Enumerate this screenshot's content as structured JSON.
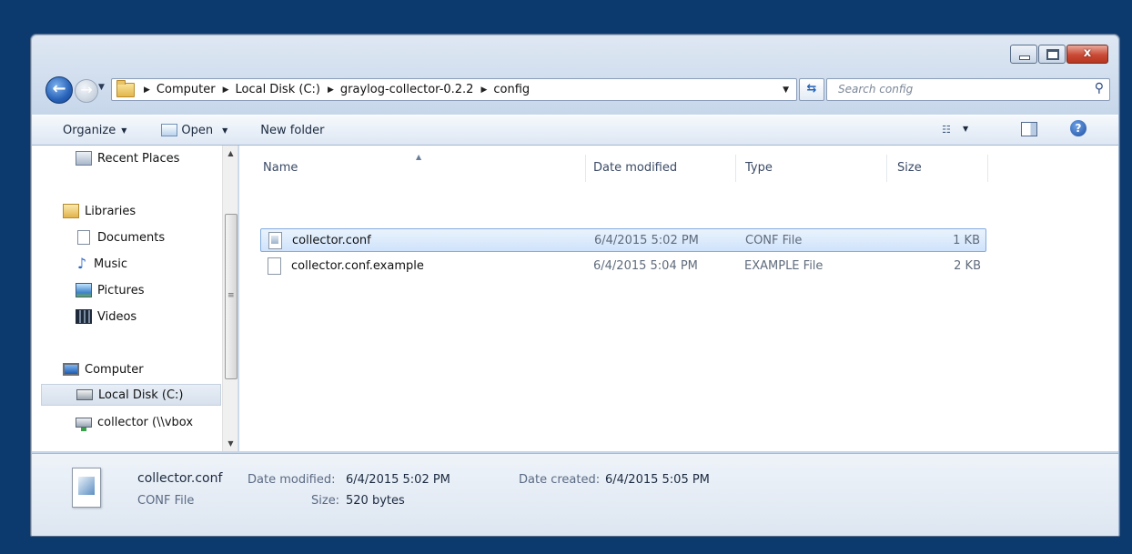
{
  "window": {
    "caption": {
      "minimize": "–",
      "maximize": "□",
      "close": "x"
    }
  },
  "address_bar": {
    "crumbs": [
      "Computer",
      "Local Disk (C:)",
      "graylog-collector-0.2.2",
      "config"
    ],
    "search_placeholder": "Search config"
  },
  "toolbar": {
    "organize": "Organize",
    "open": "Open",
    "new_folder": "New folder"
  },
  "nav": {
    "items": [
      {
        "label": "Recent Places",
        "icon": "recent-places-icon"
      },
      {
        "label": "Libraries",
        "icon": "libraries-icon"
      },
      {
        "label": "Documents",
        "icon": "documents-icon"
      },
      {
        "label": "Music",
        "icon": "music-icon"
      },
      {
        "label": "Pictures",
        "icon": "pictures-icon"
      },
      {
        "label": "Videos",
        "icon": "videos-icon"
      },
      {
        "label": "Computer",
        "icon": "computer-icon"
      },
      {
        "label": "Local Disk (C:)",
        "icon": "local-disk-icon",
        "selected": true
      },
      {
        "label": "collector (\\\\vbox",
        "icon": "network-drive-icon"
      }
    ]
  },
  "file_list": {
    "columns": [
      "Name",
      "Date modified",
      "Type",
      "Size"
    ],
    "rows": [
      {
        "name": "collector.conf",
        "date": "6/4/2015 5:02 PM",
        "type": "CONF File",
        "size": "1 KB",
        "selected": true
      },
      {
        "name": "collector.conf.example",
        "date": "6/4/2015 5:04 PM",
        "type": "EXAMPLE File",
        "size": "2 KB",
        "selected": false
      }
    ]
  },
  "details": {
    "name": "collector.conf",
    "type": "CONF File",
    "date_modified_label": "Date modified:",
    "date_modified": "6/4/2015 5:02 PM",
    "size_label": "Size:",
    "size": "520 bytes",
    "date_created_label": "Date created:",
    "date_created": "6/4/2015 5:05 PM"
  },
  "colors": {
    "desktop": "#0c3a6e",
    "selection_border": "#84acdd",
    "close_button": "#c94a35"
  }
}
